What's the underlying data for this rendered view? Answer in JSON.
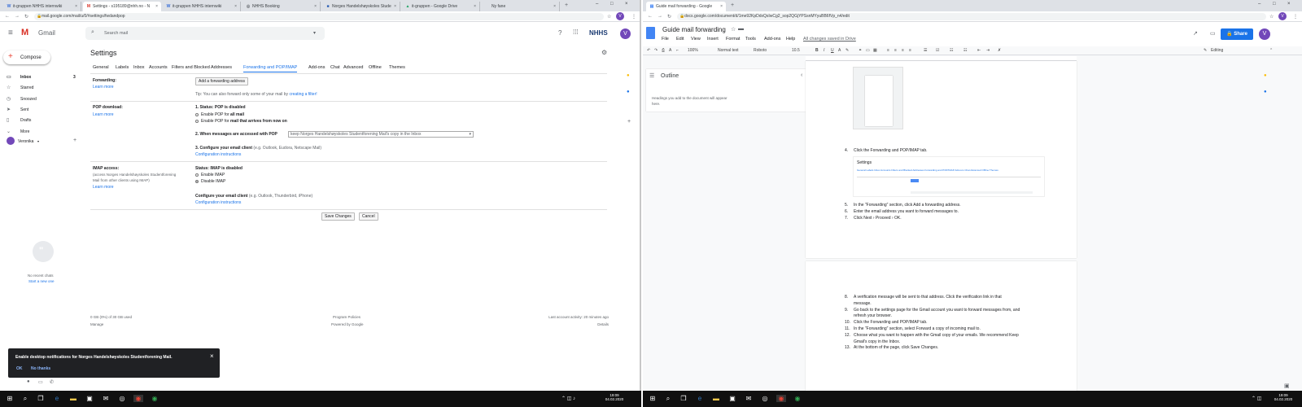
{
  "left": {
    "tabs": [
      {
        "icon": "W",
        "label": "it-gruppen NHHS internwiki",
        "color": "#3a6fd8"
      },
      {
        "icon": "M",
        "label": "Settings - s195189@nhh.no - N",
        "color": "#d93025"
      },
      {
        "icon": "W",
        "label": "it-gruppen NHHS internwiki",
        "color": "#3a6fd8"
      },
      {
        "icon": "◎",
        "label": "NHHS Booking",
        "color": "#5f6368"
      },
      {
        "icon": "■",
        "label": "Norges Handelshøyskoles Stude",
        "color": "#2d5fb4"
      },
      {
        "icon": "▲",
        "label": "it-gruppen - Google Drive",
        "color": "#1fa463"
      },
      {
        "icon": "",
        "label": "Ny fane",
        "color": "#5f6368"
      }
    ],
    "url": "mail.google.com/mail/u/0/#settings/fwdandpop",
    "gmail": {
      "logo": "Gmail",
      "search_placeholder": "Search mail",
      "brand": "NHHS",
      "avatar": "V",
      "compose": "Compose",
      "nav": [
        {
          "icon": "inbox-icon",
          "glyph": "▭",
          "label": "Inbox",
          "count": "3",
          "bold": true
        },
        {
          "icon": "star-icon",
          "glyph": "☆",
          "label": "Starred",
          "count": ""
        },
        {
          "icon": "clock-icon",
          "glyph": "◷",
          "label": "Snoozed",
          "count": ""
        },
        {
          "icon": "send-icon",
          "glyph": "➤",
          "label": "Sent",
          "count": ""
        },
        {
          "icon": "file-icon",
          "glyph": "▯",
          "label": "Drafts",
          "count": ""
        },
        {
          "icon": "chevron-down-icon",
          "glyph": "⌄",
          "label": "More",
          "count": ""
        }
      ],
      "user": "Veronika",
      "no_chats": "No recent chats",
      "start_new": "Start a new one",
      "settings_title": "Settings",
      "settings_tabs": [
        "General",
        "Labels",
        "Inbox",
        "Accounts",
        "Filters and Blocked Addresses",
        "Forwarding and POP/IMAP",
        "Add-ons",
        "Chat",
        "Advanced",
        "Offline",
        "Themes"
      ],
      "active_tab": 5,
      "forwarding": {
        "label": "Forwarding:",
        "learn": "Learn more",
        "button": "Add a forwarding address",
        "tip": "Tip: You can also forward only some of your mail by ",
        "tip_link": "creating a filter!"
      },
      "pop": {
        "label": "POP download:",
        "learn": "Learn more",
        "status": "1. Status: POP is disabled",
        "opt1_pre": "Enable POP for ",
        "opt1_b": "all mail",
        "opt2_pre": "Enable POP for ",
        "opt2_b": "mail that arrives from now on",
        "q2": "2. When messages are accessed with POP",
        "select": "keep Norges Handelshøyskoles Studentforening Mail's copy in the Inbox",
        "q3_b": "3. Configure your email client",
        "q3_rest": " (e.g. Outlook, Eudora, Netscape Mail)",
        "config": "Configuration instructions"
      },
      "imap": {
        "label": "IMAP access:",
        "desc1": "(access Norges Handelshøyskoles Studentforening",
        "desc2": "Mail from other clients using IMAP)",
        "learn": "Learn more",
        "status": "Status: IMAP is disabled",
        "opt1": "Enable IMAP",
        "opt2": "Disable IMAP",
        "conf_b": "Configure your email client",
        "conf_rest": " (e.g. Outlook, Thunderbird, iPhone)",
        "config": "Configuration instructions"
      },
      "save": "Save Changes",
      "cancel": "Cancel",
      "footer": {
        "usage": "0 GB (0%) of 30 GB used",
        "manage": "Manage",
        "policies": "Program Policies",
        "powered": "Powered by Google",
        "activity": "Last account activity: 20 minutes ago",
        "details": "Details"
      },
      "notification": {
        "text": "Enable desktop notifications for Norges Handelshøyskoles Studentforening Mail.",
        "ok": "OK",
        "no": "No thanks",
        "close": "×"
      }
    },
    "clock": {
      "time": "19:09",
      "date": "04.02.2020"
    }
  },
  "right": {
    "tabs": [
      {
        "icon": "▤",
        "label": "Guide mail forwarding - Google",
        "color": "#4285f4"
      }
    ],
    "url": "docs.google.com/document/d/1me92KpDdxQsIwCg2_sop2QGjYPSsnMYyuBB6fVp_n4/edit",
    "avatar": "V",
    "doc": {
      "title": "Guide mail forwarding",
      "menus": [
        "File",
        "Edit",
        "View",
        "Insert",
        "Format",
        "Tools",
        "Add-ons",
        "Help"
      ],
      "saved": "All changes saved in Drive",
      "share": "Share",
      "zoom": "100%",
      "style": "Normal text",
      "font": "Roboto",
      "size": "10.5",
      "editing": "Editing",
      "outline_title": "Outline",
      "outline_text": "Headings you add to the document will appear here.",
      "steps_a": [
        {
          "n": "4.",
          "t": "Click the Forwarding and POP/IMAP tab."
        }
      ],
      "steps_b": [
        {
          "n": "5.",
          "t": "In the \"Forwarding\" section, click Add a forwarding address."
        },
        {
          "n": "6.",
          "t": "Enter the email address you want to forward messages to."
        },
        {
          "n": "7.",
          "t": "Click Next › Proceed › OK."
        }
      ],
      "steps_c": [
        {
          "n": "8.",
          "t": "A verification message will be sent to that address. Click the verification link in that",
          "t2": "message."
        },
        {
          "n": "9.",
          "t": "Go back to the settings page for the Gmail account you want to forward messages from, and",
          "t2": "refresh your browser."
        },
        {
          "n": "10.",
          "t": "Click the Forwarding and POP/IMAP tab."
        },
        {
          "n": "11.",
          "t": "In the \"Forwarding\" section, select Forward a copy of incoming mail to."
        },
        {
          "n": "12.",
          "t": "Choose what you want to happen with the Gmail copy of your emails. We recommend Keep",
          "t2": "Gmail's copy in the Inbox."
        },
        {
          "n": "13.",
          "t": "At the bottom of the page, click Save Changes."
        }
      ],
      "mini_settings": {
        "title": "Settings",
        "tabs": "General  Labels  Inbox  Accounts  Filters and Blocked Addresses  Forwarding and POP/IMAP  Add-ons  Chat  Advanced  Offline  Themes"
      }
    },
    "clock": {
      "time": "19:09",
      "date": "04.02.2020"
    }
  }
}
